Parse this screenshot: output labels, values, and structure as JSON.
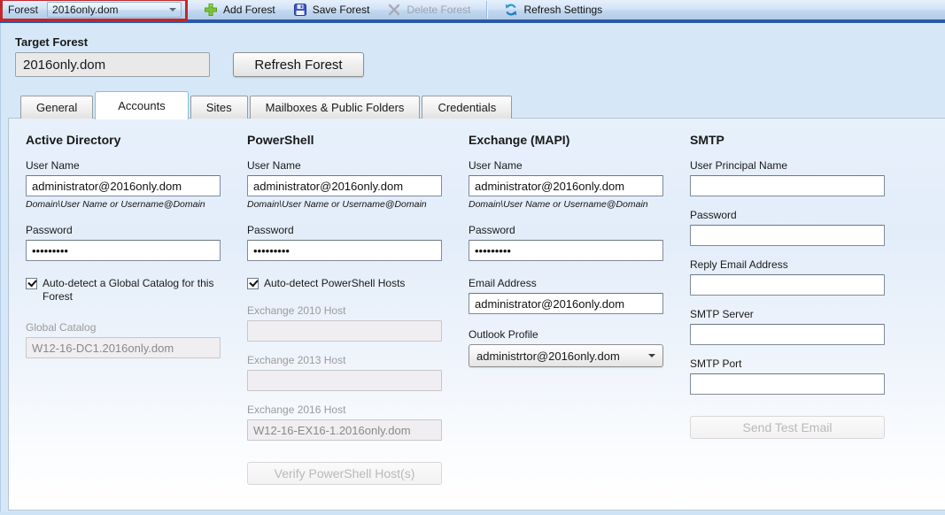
{
  "toolbar": {
    "forest_label": "Forest",
    "forest_dropdown_value": "2016only.dom",
    "add_forest_label": "Add Forest",
    "save_forest_label": "Save Forest",
    "delete_forest_label": "Delete Forest",
    "refresh_settings_label": "Refresh Settings"
  },
  "target_forest": {
    "label": "Target Forest",
    "value": "2016only.dom",
    "refresh_button_label": "Refresh Forest"
  },
  "tabs": [
    {
      "label": "General",
      "selected": false
    },
    {
      "label": "Accounts",
      "selected": true
    },
    {
      "label": "Sites",
      "selected": false
    },
    {
      "label": "Mailboxes & Public Folders",
      "selected": false
    },
    {
      "label": "Credentials",
      "selected": false
    }
  ],
  "accounts_tab": {
    "active_directory": {
      "header": "Active Directory",
      "user_name_label": "User Name",
      "user_name_value": "administrator@2016only.dom",
      "user_name_hint": "Domain\\User Name or Username@Domain",
      "password_label": "Password",
      "password_value": "•••••••••",
      "autodetect_label": "Auto-detect a Global Catalog for this Forest",
      "autodetect_checked": true,
      "global_catalog_label": "Global Catalog",
      "global_catalog_value": "W12-16-DC1.2016only.dom"
    },
    "powershell": {
      "header": "PowerShell",
      "user_name_label": "User Name",
      "user_name_value": "administrator@2016only.dom",
      "user_name_hint": "Domain\\User Name or Username@Domain",
      "password_label": "Password",
      "password_value": "•••••••••",
      "autodetect_label": "Auto-detect PowerShell Hosts",
      "autodetect_checked": true,
      "exchange_2010_label": "Exchange 2010 Host",
      "exchange_2010_value": "",
      "exchange_2013_label": "Exchange 2013 Host",
      "exchange_2013_value": "",
      "exchange_2016_label": "Exchange 2016 Host",
      "exchange_2016_value": "W12-16-EX16-1.2016only.dom",
      "verify_button_label": "Verify PowerShell Host(s)"
    },
    "exchange_mapi": {
      "header": "Exchange (MAPI)",
      "user_name_label": "User Name",
      "user_name_value": "administrator@2016only.dom",
      "user_name_hint": "Domain\\User Name or Username@Domain",
      "password_label": "Password",
      "password_value": "•••••••••",
      "email_address_label": "Email Address",
      "email_address_value": "administrator@2016only.dom",
      "outlook_profile_label": "Outlook Profile",
      "outlook_profile_value": "administrtor@2016only.dom"
    },
    "smtp": {
      "header": "SMTP",
      "upn_label": "User Principal Name",
      "upn_value": "",
      "password_label": "Password",
      "password_value": "",
      "reply_label": "Reply Email Address",
      "reply_value": "",
      "server_label": "SMTP Server",
      "server_value": "",
      "port_label": "SMTP Port",
      "port_value": "",
      "send_test_button_label": "Send Test Email"
    }
  },
  "colors": {
    "annotation_red": "#c0282d",
    "toolbar_strip_blue": "#2b5aa4",
    "selected_tab_border": "#7fc2dc",
    "app_background": "#cfe3f6"
  }
}
